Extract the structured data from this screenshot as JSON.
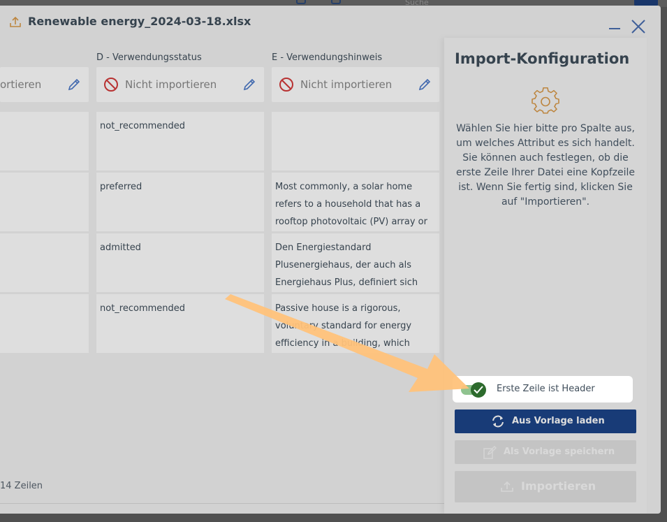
{
  "background": {
    "search_label": "Suche"
  },
  "modal": {
    "title": "Renewable energy_2024-03-18.xlsx",
    "columns": [
      {
        "header": "",
        "selector": "ortieren"
      },
      {
        "header": "D - Verwendungsstatus",
        "selector": "Nicht importieren"
      },
      {
        "header": "E - Verwendungshinweis",
        "selector": "Nicht importieren"
      }
    ],
    "rows": [
      {
        "d": "not_recommended",
        "e": ""
      },
      {
        "d": "preferred",
        "e": "Most commonly, a solar home refers to a household that has a rooftop photovoltaic (PV) array or"
      },
      {
        "d": "admitted",
        "e": "Den Energiestandard Plusenergiehaus, der auch als Energiehaus Plus, definiert sich"
      },
      {
        "d": "not_recommended",
        "e": "Passive house is a rigorous, voluntary standard for energy efficiency in a building, which"
      }
    ],
    "row_count": "14 Zeilen"
  },
  "panel": {
    "title": "Import-Konfiguration",
    "description": "Wählen Sie hier bitte pro Spalte aus, um welches Attribut es sich handelt. Sie können auch festlegen, ob die erste Zeile Ihrer Datei eine Kopfzeile ist. Wenn Sie fertig sind, klicken Sie auf \"Importieren\".",
    "toggle": {
      "label": "Erste Zeile ist Header",
      "checked": true
    },
    "load_template_label": "Aus Vorlage laden",
    "save_template_label": "Als Vorlage speichern",
    "import_label": "Importieren"
  },
  "colors": {
    "primary": "#1c4489",
    "toggle_on": "#2d6b2d",
    "ban_red": "#d43a3a",
    "edit_blue": "#4a78c8",
    "arrow": "#ffc27a",
    "gear": "#d99a4a"
  }
}
